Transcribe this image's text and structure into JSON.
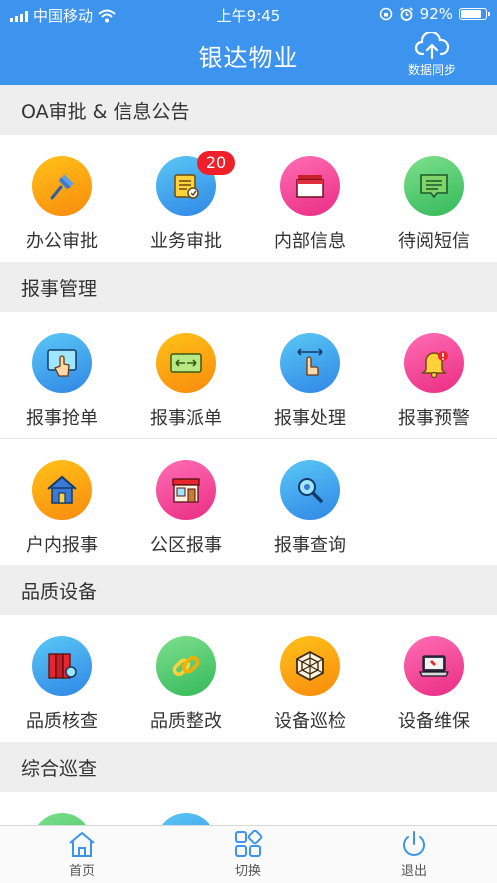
{
  "status_bar": {
    "carrier": "中国移动",
    "time": "上午9:45",
    "battery": "92%",
    "battery_level": 0.92
  },
  "header": {
    "title": "银达物业",
    "sync_label": "数据同步"
  },
  "sections": [
    {
      "title": "OA审批 & 信息公告",
      "items": [
        {
          "label": "办公审批",
          "icon": "pin-icon"
        },
        {
          "label": "业务审批",
          "icon": "document-icon",
          "badge": "20"
        },
        {
          "label": "内部信息",
          "icon": "folder-icon"
        },
        {
          "label": "待阅短信",
          "icon": "message-icon"
        }
      ]
    },
    {
      "title": "报事管理",
      "items": [
        {
          "label": "报事抢单",
          "icon": "touch-screen-icon"
        },
        {
          "label": "报事派单",
          "icon": "dispatch-icon"
        },
        {
          "label": "报事处理",
          "icon": "hand-swipe-icon"
        },
        {
          "label": "报事预警",
          "icon": "bell-alert-icon"
        },
        {
          "label": "户内报事",
          "icon": "house-icon"
        },
        {
          "label": "公区报事",
          "icon": "storefront-icon"
        },
        {
          "label": "报事查询",
          "icon": "magnifier-icon"
        }
      ]
    },
    {
      "title": "品质设备",
      "items": [
        {
          "label": "品质核查",
          "icon": "binders-icon"
        },
        {
          "label": "品质整改",
          "icon": "chain-link-icon"
        },
        {
          "label": "设备巡检",
          "icon": "web-hexagon-icon"
        },
        {
          "label": "设备维保",
          "icon": "laptop-repair-icon"
        }
      ]
    },
    {
      "title": "综合巡查",
      "items": []
    }
  ],
  "tabbar": [
    {
      "label": "首页",
      "icon": "home-icon"
    },
    {
      "label": "切换",
      "icon": "grid-switch-icon"
    },
    {
      "label": "退出",
      "icon": "power-icon"
    }
  ],
  "colors": {
    "primary": "#3d94ee",
    "badge": "#f0202a",
    "section_bg": "#eeeeee"
  }
}
